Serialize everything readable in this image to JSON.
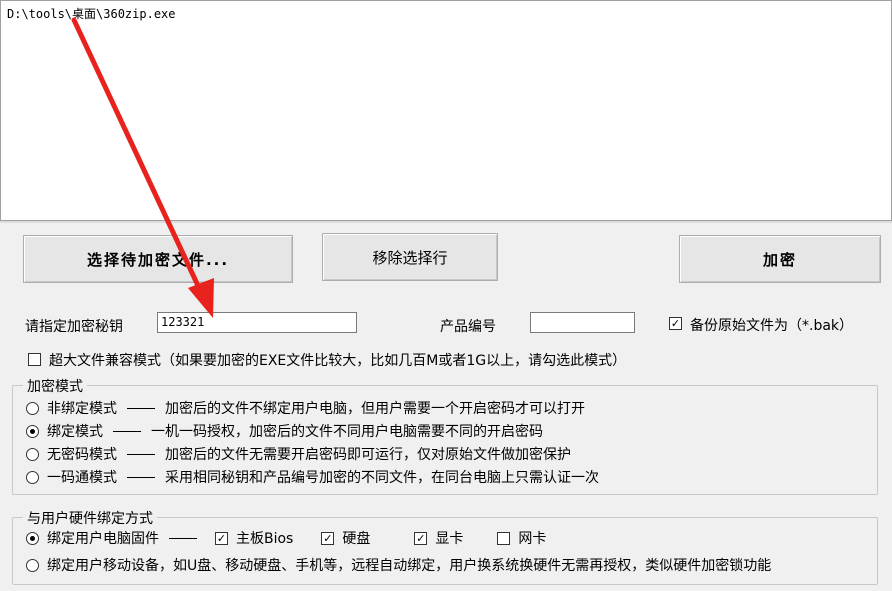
{
  "file_list": {
    "items": [
      "D:\\tools\\桌面\\360zip.exe"
    ]
  },
  "buttons": {
    "select_files": "选择待加密文件...",
    "remove_row": "移除选择行",
    "encrypt": "加密"
  },
  "key": {
    "label": "请指定加密秘钥",
    "value": "123321"
  },
  "product": {
    "label": "产品编号",
    "value": ""
  },
  "backup": {
    "checked": true,
    "label": "备份原始文件为（*.bak）"
  },
  "large_file": {
    "checked": false,
    "label": "超大文件兼容模式（如果要加密的EXE文件比较大，比如几百M或者1G以上，请勾选此模式）"
  },
  "mode_group": {
    "title": "加密模式",
    "options": [
      {
        "name": "非绑定模式",
        "desc": "加密后的文件不绑定用户电脑，但用户需要一个开启密码才可以打开",
        "selected": false
      },
      {
        "name": "绑定模式",
        "desc": "一机一码授权，加密后的文件不同用户电脑需要不同的开启密码",
        "selected": true
      },
      {
        "name": "无密码模式",
        "desc": "加密后的文件无需要开启密码即可运行，仅对原始文件做加密保护",
        "selected": false
      },
      {
        "name": "一码通模式",
        "desc": "采用相同秘钥和产品编号加密的不同文件，在同台电脑上只需认证一次",
        "selected": false
      }
    ]
  },
  "bind_group": {
    "title": "与用户硬件绑定方式",
    "firmware": {
      "label": "绑定用户电脑固件",
      "selected": true,
      "hardware": [
        {
          "label": "主板Bios",
          "checked": true
        },
        {
          "label": "硬盘",
          "checked": true
        },
        {
          "label": "显卡",
          "checked": true
        },
        {
          "label": "网卡",
          "checked": false
        }
      ]
    },
    "mobile": {
      "label": "绑定用户移动设备，如U盘、移动硬盘、手机等，远程自动绑定，用户换系统换硬件无需再授权，类似硬件加密锁功能",
      "selected": false
    }
  },
  "annotation": {
    "arrow_color": "#e8231e"
  }
}
